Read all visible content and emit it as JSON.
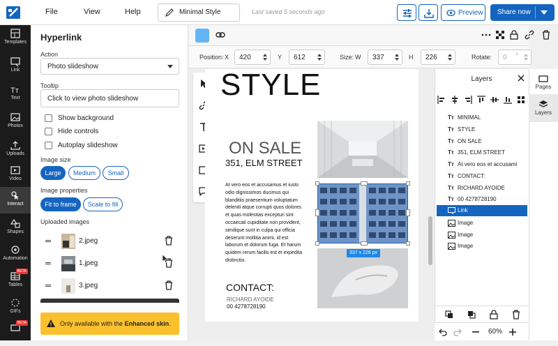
{
  "menu": {
    "file": "File",
    "view": "View",
    "help": "Help"
  },
  "doc": {
    "name": "Minimal Style",
    "saved": "Last saved 5 seconds ago"
  },
  "topbar": {
    "preview": "Preview",
    "share": "Share now"
  },
  "rail": [
    "Templates",
    "Link",
    "Text",
    "Photos",
    "Uploads",
    "Video",
    "Interact",
    "Shapes",
    "Automation",
    "Tables",
    "GIFs",
    "BETA"
  ],
  "rail_badges": {
    "automation": "BETA",
    "last": "BETA"
  },
  "panel": {
    "title": "Hyperlink",
    "action_label": "Action",
    "action_value": "Photo slideshow",
    "tooltip_label": "Tooltip",
    "tooltip_value": "Click to view photo slideshow",
    "checkboxes": [
      "Show background",
      "Hide controls",
      "Autoplay slideshow"
    ],
    "image_size_label": "Image size",
    "sizes": [
      "Large",
      "Medium",
      "Small"
    ],
    "image_props_label": "Image properties",
    "props": [
      "Fit to frame",
      "Scale to fill"
    ],
    "uploaded_label": "Uploaded images",
    "uploads": [
      "2.jpeg",
      "1.jpeg",
      "3.jpeg"
    ],
    "notice_pre": "Only available with the",
    "notice_bold": "Enhanced skin",
    "notice_post": "."
  },
  "position": {
    "label": "Position:",
    "x_label": "X",
    "x": "420",
    "y_label": "Y",
    "y": "612",
    "size_label": "Size:",
    "w_label": "W",
    "w": "337",
    "h_label": "H",
    "h": "226",
    "rotate_label": "Rotate:",
    "rotate": "0",
    "deg": "°"
  },
  "page": {
    "style": "STYLE",
    "on_sale": "ON SALE",
    "address": "351, ELM STREET",
    "body": "At vero eos et accusamus et iusto odio dignissimos ducimus qui blanditiis praesentium voluptatum deleniti atque corrupti quos dolores et quas molestias excepturi sint occaecati cupiditate non provident, similique sunt in culpa qui officia deserunt mollitia animi, id est laborum et dolorum fuga. Et harum quidem rerum facilis est et expedita distinctio.",
    "contact": "CONTACT:",
    "name": "RICHARD AYOIDE",
    "phone": "00 4278728190",
    "size_badge": "337 x 226 px"
  },
  "layers": {
    "title": "Layers",
    "items": [
      {
        "icon": "Tт",
        "label": "MINIMAL"
      },
      {
        "icon": "Tт",
        "label": "STYLE"
      },
      {
        "icon": "Tт",
        "label": "ON SALE"
      },
      {
        "icon": "Tт",
        "label": "351, ELM STREET"
      },
      {
        "icon": "Tт",
        "label": "At vero eos et accusami"
      },
      {
        "icon": "Tт",
        "label": "CONTACT:"
      },
      {
        "icon": "Tт",
        "label": "RICHARD AYOIDE"
      },
      {
        "icon": "Tт",
        "label": "00 4278728190"
      },
      {
        "icon": "link",
        "label": "Link"
      },
      {
        "icon": "image",
        "label": "Image"
      },
      {
        "icon": "image",
        "label": "Image"
      },
      {
        "icon": "image",
        "label": "Image"
      }
    ]
  },
  "right_tabs": {
    "pages": "Pages",
    "layers": "Layers"
  },
  "zoom": "60%",
  "colors": {
    "accent": "#1565c0",
    "notice": "#fbc02d",
    "swatch": "#64b5f6"
  }
}
